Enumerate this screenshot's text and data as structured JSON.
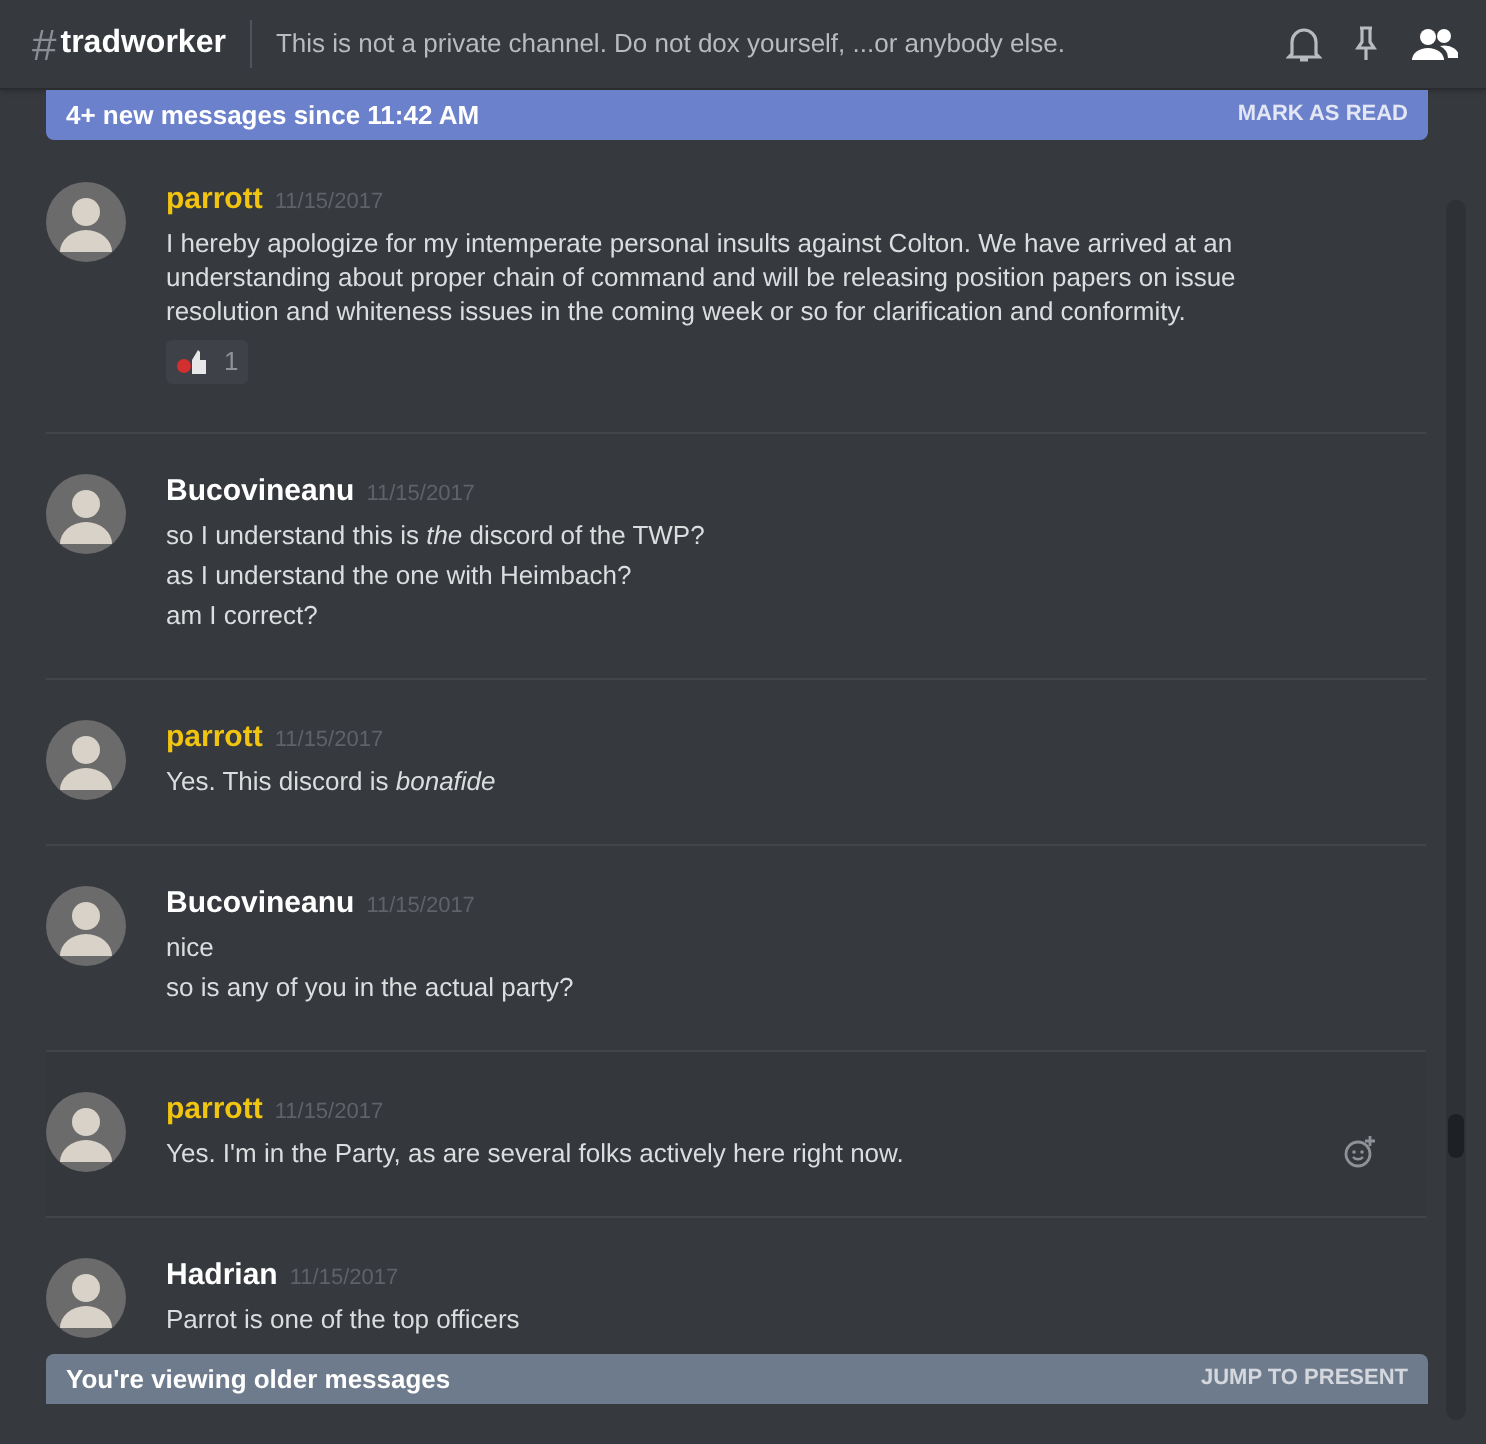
{
  "header": {
    "hash": "#",
    "channel": "tradworker",
    "topic": "This is not a private channel. Do not dox yourself, ...or anybody else."
  },
  "new_messages_bar": {
    "text": "4+ new messages since 11:42 AM",
    "action": "MARK AS READ"
  },
  "messages": [
    {
      "author": "parrott",
      "color": "#f1c40f",
      "time": "11/15/2017",
      "lines": [
        "I hereby apologize for my intemperate personal insults against Colton. We have arrived at an understanding about proper chain of command and will be releasing position papers on issue resolution and whiteness issues in the coming week or so for clarification and conformity."
      ],
      "reaction": {
        "count": "1"
      },
      "hovered": false
    },
    {
      "author": "Bucovineanu",
      "color": "#ffffff",
      "time": "11/15/2017",
      "lines": [
        "so I understand this is *the* discord of the TWP?",
        "as I understand the one with Heimbach?",
        "am I correct?"
      ],
      "hovered": false
    },
    {
      "author": "parrott",
      "color": "#f1c40f",
      "time": "11/15/2017",
      "lines": [
        "Yes. This discord is *bonafide*"
      ],
      "hovered": false
    },
    {
      "author": "Bucovineanu",
      "color": "#ffffff",
      "time": "11/15/2017",
      "lines": [
        "nice",
        "so is any of you in the actual party?"
      ],
      "hovered": false
    },
    {
      "author": "parrott",
      "color": "#f1c40f",
      "time": "11/15/2017",
      "lines": [
        "Yes. I'm in the Party, as are several folks actively here right now."
      ],
      "hovered": true
    },
    {
      "author": "Hadrian",
      "color": "#ffffff",
      "time": "11/15/2017",
      "lines": [
        "Parrot is one of the top officers"
      ],
      "hovered": false
    }
  ],
  "older_bar": {
    "text": "You're viewing older messages",
    "action": "JUMP TO PRESENT"
  }
}
